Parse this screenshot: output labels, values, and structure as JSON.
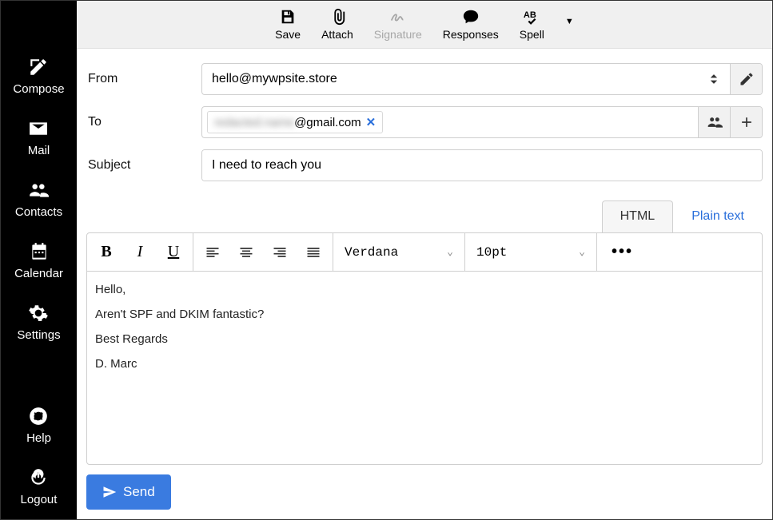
{
  "sidebar": {
    "items": [
      {
        "label": "Compose"
      },
      {
        "label": "Mail"
      },
      {
        "label": "Contacts"
      },
      {
        "label": "Calendar"
      },
      {
        "label": "Settings"
      }
    ],
    "bottom": [
      {
        "label": "Help"
      },
      {
        "label": "Logout"
      }
    ]
  },
  "toolbar": {
    "save": "Save",
    "attach": "Attach",
    "signature": "Signature",
    "responses": "Responses",
    "spell": "Spell"
  },
  "form": {
    "from_label": "From",
    "from_value": "hello@mywpsite.store",
    "to_label": "To",
    "to_chip_hidden": "redacted.name",
    "to_chip_visible": "@gmail.com",
    "subject_label": "Subject",
    "subject_value": "I need to reach you"
  },
  "editor": {
    "tabs": {
      "html": "HTML",
      "plain": "Plain text"
    },
    "font_family": "Verdana",
    "font_size": "10pt",
    "body": {
      "l1": "Hello,",
      "l2": "Aren't SPF and DKIM fantastic?",
      "l3": "Best Regards",
      "l4": "D. Marc"
    }
  },
  "send_label": "Send"
}
